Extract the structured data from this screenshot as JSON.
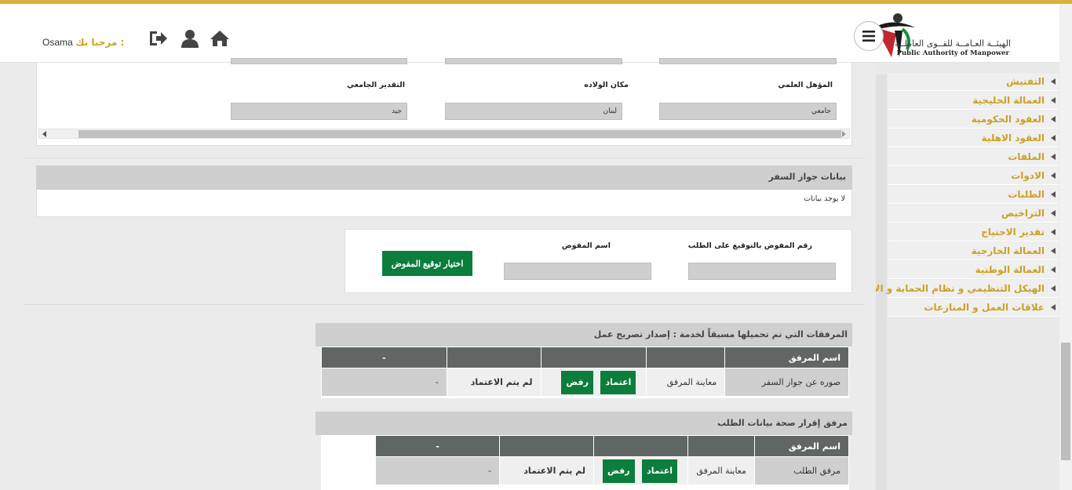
{
  "header": {
    "logo_ar": "الهيئــة العـامــة للقــوى العاملــة",
    "logo_en": "Public Authority of Manpower",
    "welcome_label": "مرحبا بك :",
    "username": "Osama",
    "colors": {
      "accent": "#d7b23c",
      "green": "#0b7d3c",
      "gold_text": "#c9a227"
    },
    "icons": [
      "menu-icon",
      "home-icon",
      "user-icon",
      "logout-icon"
    ]
  },
  "sidebar": {
    "items": [
      {
        "label": "التفتيش"
      },
      {
        "label": "العمالة الخليجية"
      },
      {
        "label": "العقود الحكومية"
      },
      {
        "label": "العقود الاهلية"
      },
      {
        "label": "الملفات"
      },
      {
        "label": "الادوات"
      },
      {
        "label": "الطلبات"
      },
      {
        "label": "التراخيص"
      },
      {
        "label": "تقدير الاحتياج"
      },
      {
        "label": "العمالة الخارجية"
      },
      {
        "label": "العمالة الوطنية"
      },
      {
        "label": "الهيكل التنظيمي و نظام الحماية و الامن"
      },
      {
        "label": "علاقات العمل و المنازعات"
      }
    ]
  },
  "personal": {
    "fields": [
      {
        "label": "المؤهل العلمي",
        "value": "جامعي"
      },
      {
        "label": "مكان الولاده",
        "value": "لبنان"
      },
      {
        "label": "التقدير الجامعي",
        "value": "جيد"
      }
    ]
  },
  "passport": {
    "title": "بيانات جواز السفر",
    "empty": "لا يوجد بيانات"
  },
  "signature": {
    "number_label": "رقم المفوض بالتوقيع على الطلب",
    "name_label": "اسم المفوض",
    "select_button": "اختيار توقيع المفوض"
  },
  "attachments1": {
    "title": "المرفقات التي تم تحميلها مسبقاً لخدمة : إصدار تصريح عمل",
    "headers": [
      "اسم المرفق",
      "",
      "",
      "",
      "-"
    ],
    "row": {
      "name": "صوره عن جواز السفر",
      "view": "معاينة المرفق",
      "approve": "اعتماد",
      "reject": "رفض",
      "status": "لم يتم الاعتماد",
      "last": "-"
    }
  },
  "attachments2": {
    "title": "مرفق إقرار صحة بيانات الطلب",
    "headers": [
      "اسم المرفق",
      "",
      "",
      "",
      "-"
    ],
    "row": {
      "name": "مرفق الطلب",
      "view": "معاينة المرفق",
      "approve": "اعتماد",
      "reject": "رفض",
      "status": "لم يتم الاعتماد",
      "last": "-"
    }
  }
}
